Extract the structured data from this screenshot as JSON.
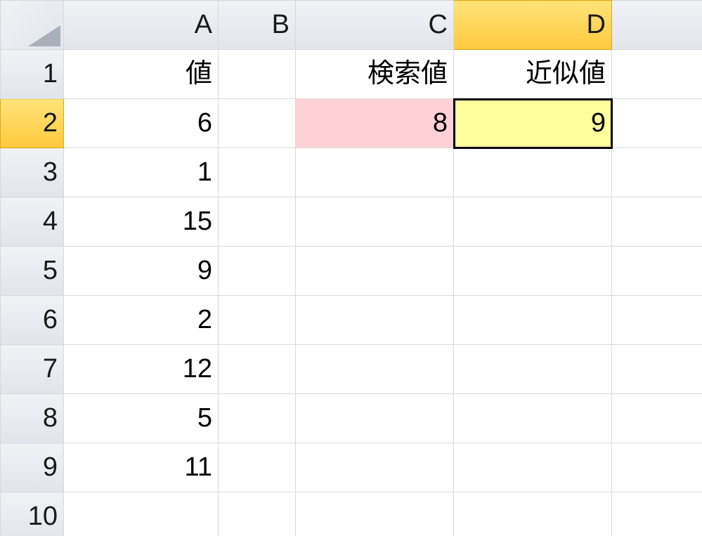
{
  "columns": {
    "A": "A",
    "B": "B",
    "C": "C",
    "D": "D"
  },
  "rows": {
    "1": "1",
    "2": "2",
    "3": "3",
    "4": "4",
    "5": "5",
    "6": "6",
    "7": "7",
    "8": "8",
    "9": "9",
    "10": "10"
  },
  "headers": {
    "A1": "値",
    "C1": "検索値",
    "D1": "近似値"
  },
  "colA": {
    "r2": "6",
    "r3": "1",
    "r4": "15",
    "r5": "9",
    "r6": "2",
    "r7": "12",
    "r8": "5",
    "r9": "11"
  },
  "C2": "8",
  "D2": "9",
  "colors": {
    "pink": "#ffd1d6",
    "yellow": "#ffff9e",
    "activeHeader": "#ffc93c"
  },
  "active_cell": "D2"
}
